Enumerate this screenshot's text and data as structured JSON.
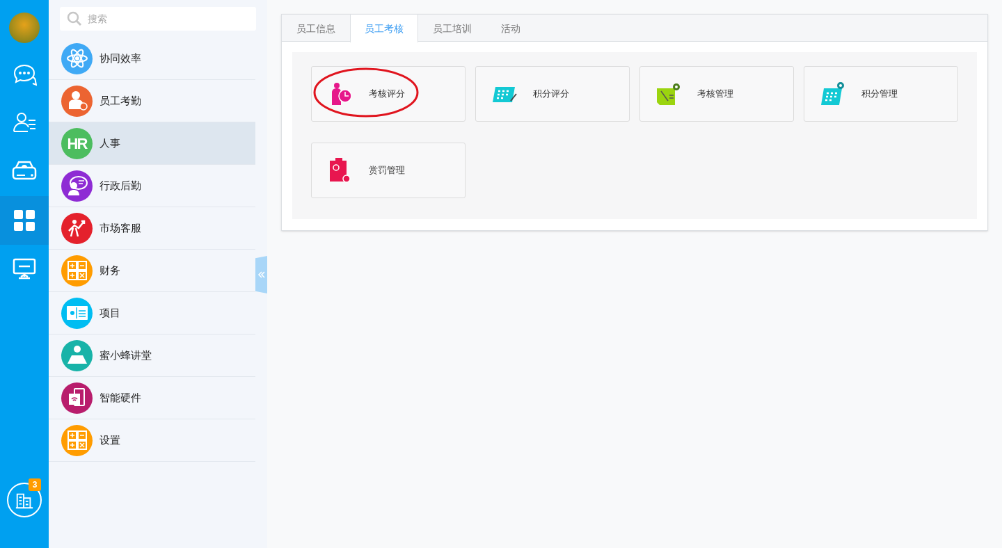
{
  "rail": {
    "items": [
      {
        "kind": "chat",
        "selected": false
      },
      {
        "kind": "contacts",
        "selected": false
      },
      {
        "kind": "cloud",
        "selected": false
      },
      {
        "kind": "apps",
        "selected": true
      },
      {
        "kind": "monitor",
        "selected": false
      }
    ],
    "bottom": {
      "badge": "3"
    }
  },
  "sidebar": {
    "search": {
      "placeholder": "搜索"
    },
    "items": [
      {
        "label": "协同效率",
        "kind": "atom",
        "color": "#3fa9f5",
        "selected": false
      },
      {
        "label": "员工考勤",
        "kind": "person",
        "color": "#ec6431",
        "selected": false
      },
      {
        "label": "人事",
        "kind": "text",
        "icon_text": "HR",
        "color": "#4cbd5f",
        "selected": true
      },
      {
        "label": "行政后勤",
        "kind": "speaker",
        "color": "#8e2bd4",
        "selected": false
      },
      {
        "label": "市场客服",
        "kind": "growth",
        "color": "#e4212c",
        "selected": false
      },
      {
        "label": "财务",
        "kind": "calc",
        "color": "#ff9c00",
        "selected": false
      },
      {
        "label": "项目",
        "kind": "card",
        "color": "#00bdf2",
        "selected": false
      },
      {
        "label": "蜜小蜂讲堂",
        "kind": "teacher",
        "color": "#18b3a8",
        "selected": false
      },
      {
        "label": "智能硬件",
        "kind": "device",
        "color": "#b81d6c",
        "selected": false
      },
      {
        "label": "设置",
        "kind": "calc",
        "color": "#ff9c00",
        "selected": false
      }
    ]
  },
  "tabs": [
    {
      "label": "员工信息",
      "selected": false
    },
    {
      "label": "员工考核",
      "selected": true
    },
    {
      "label": "员工培训",
      "selected": false
    },
    {
      "label": "活动",
      "selected": false
    }
  ],
  "cards": [
    {
      "label": "考核评分",
      "kind": "person-chart",
      "color": "#e6178a",
      "circled": true
    },
    {
      "label": "积分评分",
      "kind": "grid-pen",
      "color": "#13c9d4",
      "circled": false
    },
    {
      "label": "考核管理",
      "kind": "note-gear",
      "color": "#9bd40f",
      "circled": false
    },
    {
      "label": "积分管理",
      "kind": "grid-gear",
      "color": "#13c9d4",
      "circled": false
    },
    {
      "label": "赏罚管理",
      "kind": "clipboard",
      "color": "#e8164f",
      "circled": false
    }
  ]
}
